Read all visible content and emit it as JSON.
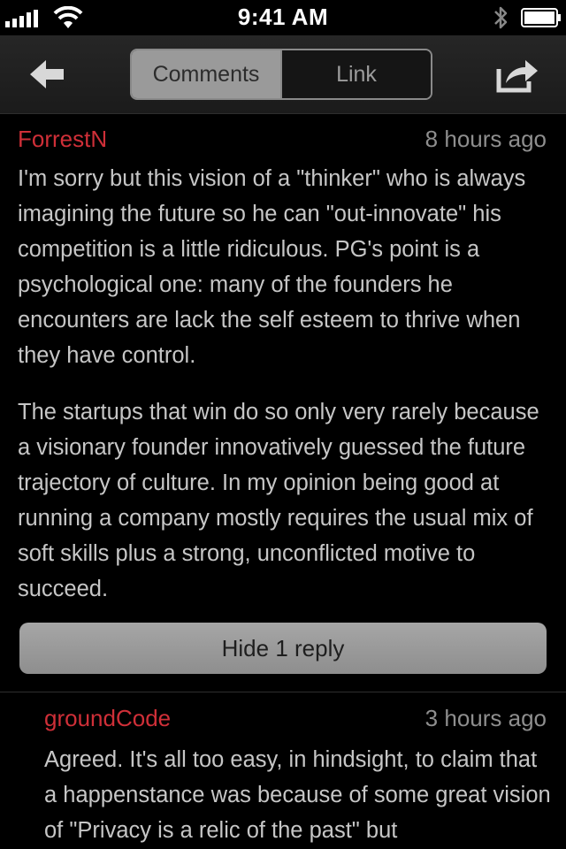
{
  "status_bar": {
    "time": "9:41 AM",
    "icons": [
      "signal-icon",
      "wifi-icon",
      "bluetooth-icon",
      "battery-icon"
    ]
  },
  "nav": {
    "back_icon": "back-arrow-icon",
    "share_icon": "share-icon",
    "tabs": [
      {
        "label": "Comments",
        "active": true
      },
      {
        "label": "Link",
        "active": false
      }
    ]
  },
  "comments": [
    {
      "author": "ForrestN",
      "time": "8 hours ago",
      "paragraphs": [
        "I'm sorry but this vision of a \"thinker\" who is always imagining the future so he can \"out-innovate\" his competition is a little ridiculous. PG's point is a psychological one: many of the founders he encounters are lack the self esteem to thrive when they have control.",
        "The startups that win do so only very rarely because a visionary founder innovatively guessed the future trajectory of culture. In my opinion being good at running a company mostly requires the usual mix of soft skills plus a strong, unconflicted motive to succeed."
      ],
      "hide_replies_label": "Hide 1 reply"
    },
    {
      "author": "groundCode",
      "time": "3 hours ago",
      "paragraphs": [
        "Agreed. It's all too easy, in hindsight, to claim that a happenstance was because of some great vision of \"Privacy is a relic of the past\" but"
      ]
    }
  ],
  "colors": {
    "author": "#cf2f38",
    "background": "#000000",
    "text": "#c6c6c6",
    "timestamp": "#8e8e8e",
    "segment_active": "#9a9a9a"
  }
}
